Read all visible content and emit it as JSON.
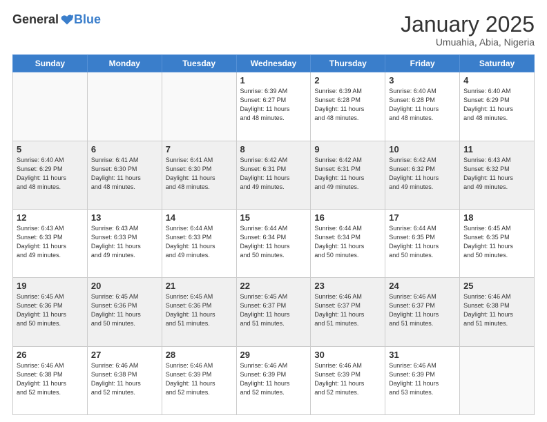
{
  "logo": {
    "general": "General",
    "blue": "Blue"
  },
  "header": {
    "month": "January 2025",
    "location": "Umuahia, Abia, Nigeria"
  },
  "days_of_week": [
    "Sunday",
    "Monday",
    "Tuesday",
    "Wednesday",
    "Thursday",
    "Friday",
    "Saturday"
  ],
  "weeks": [
    [
      {
        "day": "",
        "info": ""
      },
      {
        "day": "",
        "info": ""
      },
      {
        "day": "",
        "info": ""
      },
      {
        "day": "1",
        "info": "Sunrise: 6:39 AM\nSunset: 6:27 PM\nDaylight: 11 hours\nand 48 minutes."
      },
      {
        "day": "2",
        "info": "Sunrise: 6:39 AM\nSunset: 6:28 PM\nDaylight: 11 hours\nand 48 minutes."
      },
      {
        "day": "3",
        "info": "Sunrise: 6:40 AM\nSunset: 6:28 PM\nDaylight: 11 hours\nand 48 minutes."
      },
      {
        "day": "4",
        "info": "Sunrise: 6:40 AM\nSunset: 6:29 PM\nDaylight: 11 hours\nand 48 minutes."
      }
    ],
    [
      {
        "day": "5",
        "info": "Sunrise: 6:40 AM\nSunset: 6:29 PM\nDaylight: 11 hours\nand 48 minutes."
      },
      {
        "day": "6",
        "info": "Sunrise: 6:41 AM\nSunset: 6:30 PM\nDaylight: 11 hours\nand 48 minutes."
      },
      {
        "day": "7",
        "info": "Sunrise: 6:41 AM\nSunset: 6:30 PM\nDaylight: 11 hours\nand 48 minutes."
      },
      {
        "day": "8",
        "info": "Sunrise: 6:42 AM\nSunset: 6:31 PM\nDaylight: 11 hours\nand 49 minutes."
      },
      {
        "day": "9",
        "info": "Sunrise: 6:42 AM\nSunset: 6:31 PM\nDaylight: 11 hours\nand 49 minutes."
      },
      {
        "day": "10",
        "info": "Sunrise: 6:42 AM\nSunset: 6:32 PM\nDaylight: 11 hours\nand 49 minutes."
      },
      {
        "day": "11",
        "info": "Sunrise: 6:43 AM\nSunset: 6:32 PM\nDaylight: 11 hours\nand 49 minutes."
      }
    ],
    [
      {
        "day": "12",
        "info": "Sunrise: 6:43 AM\nSunset: 6:33 PM\nDaylight: 11 hours\nand 49 minutes."
      },
      {
        "day": "13",
        "info": "Sunrise: 6:43 AM\nSunset: 6:33 PM\nDaylight: 11 hours\nand 49 minutes."
      },
      {
        "day": "14",
        "info": "Sunrise: 6:44 AM\nSunset: 6:33 PM\nDaylight: 11 hours\nand 49 minutes."
      },
      {
        "day": "15",
        "info": "Sunrise: 6:44 AM\nSunset: 6:34 PM\nDaylight: 11 hours\nand 50 minutes."
      },
      {
        "day": "16",
        "info": "Sunrise: 6:44 AM\nSunset: 6:34 PM\nDaylight: 11 hours\nand 50 minutes."
      },
      {
        "day": "17",
        "info": "Sunrise: 6:44 AM\nSunset: 6:35 PM\nDaylight: 11 hours\nand 50 minutes."
      },
      {
        "day": "18",
        "info": "Sunrise: 6:45 AM\nSunset: 6:35 PM\nDaylight: 11 hours\nand 50 minutes."
      }
    ],
    [
      {
        "day": "19",
        "info": "Sunrise: 6:45 AM\nSunset: 6:36 PM\nDaylight: 11 hours\nand 50 minutes."
      },
      {
        "day": "20",
        "info": "Sunrise: 6:45 AM\nSunset: 6:36 PM\nDaylight: 11 hours\nand 50 minutes."
      },
      {
        "day": "21",
        "info": "Sunrise: 6:45 AM\nSunset: 6:36 PM\nDaylight: 11 hours\nand 51 minutes."
      },
      {
        "day": "22",
        "info": "Sunrise: 6:45 AM\nSunset: 6:37 PM\nDaylight: 11 hours\nand 51 minutes."
      },
      {
        "day": "23",
        "info": "Sunrise: 6:46 AM\nSunset: 6:37 PM\nDaylight: 11 hours\nand 51 minutes."
      },
      {
        "day": "24",
        "info": "Sunrise: 6:46 AM\nSunset: 6:37 PM\nDaylight: 11 hours\nand 51 minutes."
      },
      {
        "day": "25",
        "info": "Sunrise: 6:46 AM\nSunset: 6:38 PM\nDaylight: 11 hours\nand 51 minutes."
      }
    ],
    [
      {
        "day": "26",
        "info": "Sunrise: 6:46 AM\nSunset: 6:38 PM\nDaylight: 11 hours\nand 52 minutes."
      },
      {
        "day": "27",
        "info": "Sunrise: 6:46 AM\nSunset: 6:38 PM\nDaylight: 11 hours\nand 52 minutes."
      },
      {
        "day": "28",
        "info": "Sunrise: 6:46 AM\nSunset: 6:39 PM\nDaylight: 11 hours\nand 52 minutes."
      },
      {
        "day": "29",
        "info": "Sunrise: 6:46 AM\nSunset: 6:39 PM\nDaylight: 11 hours\nand 52 minutes."
      },
      {
        "day": "30",
        "info": "Sunrise: 6:46 AM\nSunset: 6:39 PM\nDaylight: 11 hours\nand 52 minutes."
      },
      {
        "day": "31",
        "info": "Sunrise: 6:46 AM\nSunset: 6:39 PM\nDaylight: 11 hours\nand 53 minutes."
      },
      {
        "day": "",
        "info": ""
      }
    ]
  ]
}
